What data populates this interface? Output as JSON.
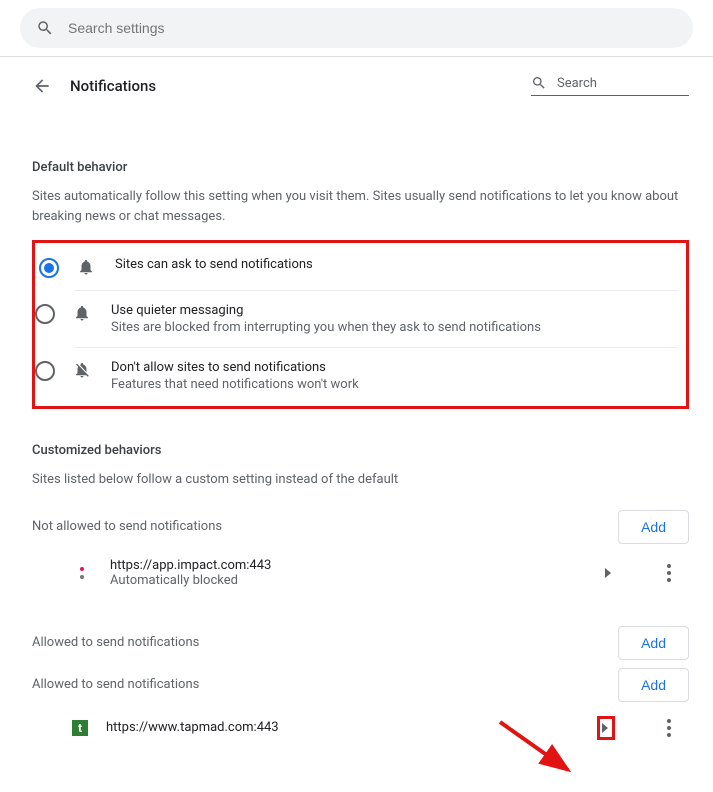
{
  "searchbar": {
    "placeholder": "Search settings"
  },
  "header": {
    "title": "Notifications",
    "mini_search": "Search"
  },
  "default_behavior": {
    "title": "Default behavior",
    "desc": "Sites automatically follow this setting when you visit them. Sites usually send notifications to let you know about breaking news or chat messages.",
    "options": [
      {
        "label": "Sites can ask to send notifications",
        "sub": "",
        "selected": true
      },
      {
        "label": "Use quieter messaging",
        "sub": "Sites are blocked from interrupting you when they ask to send notifications",
        "selected": false
      },
      {
        "label": "Don't allow sites to send notifications",
        "sub": "Features that need notifications won't work",
        "selected": false
      }
    ]
  },
  "customized": {
    "title": "Customized behaviors",
    "desc": "Sites listed below follow a custom setting instead of the default"
  },
  "lists": {
    "not_allowed": {
      "label": "Not allowed to send notifications",
      "add": "Add",
      "sites": [
        {
          "url": "https://app.impact.com:443",
          "sub": "Automatically blocked"
        }
      ]
    },
    "allowed1": {
      "label": "Allowed to send notifications",
      "add": "Add"
    },
    "allowed2": {
      "label": "Allowed to send notifications",
      "add": "Add",
      "sites": [
        {
          "url": "https://www.tapmad.com:443",
          "sub": ""
        }
      ]
    }
  }
}
